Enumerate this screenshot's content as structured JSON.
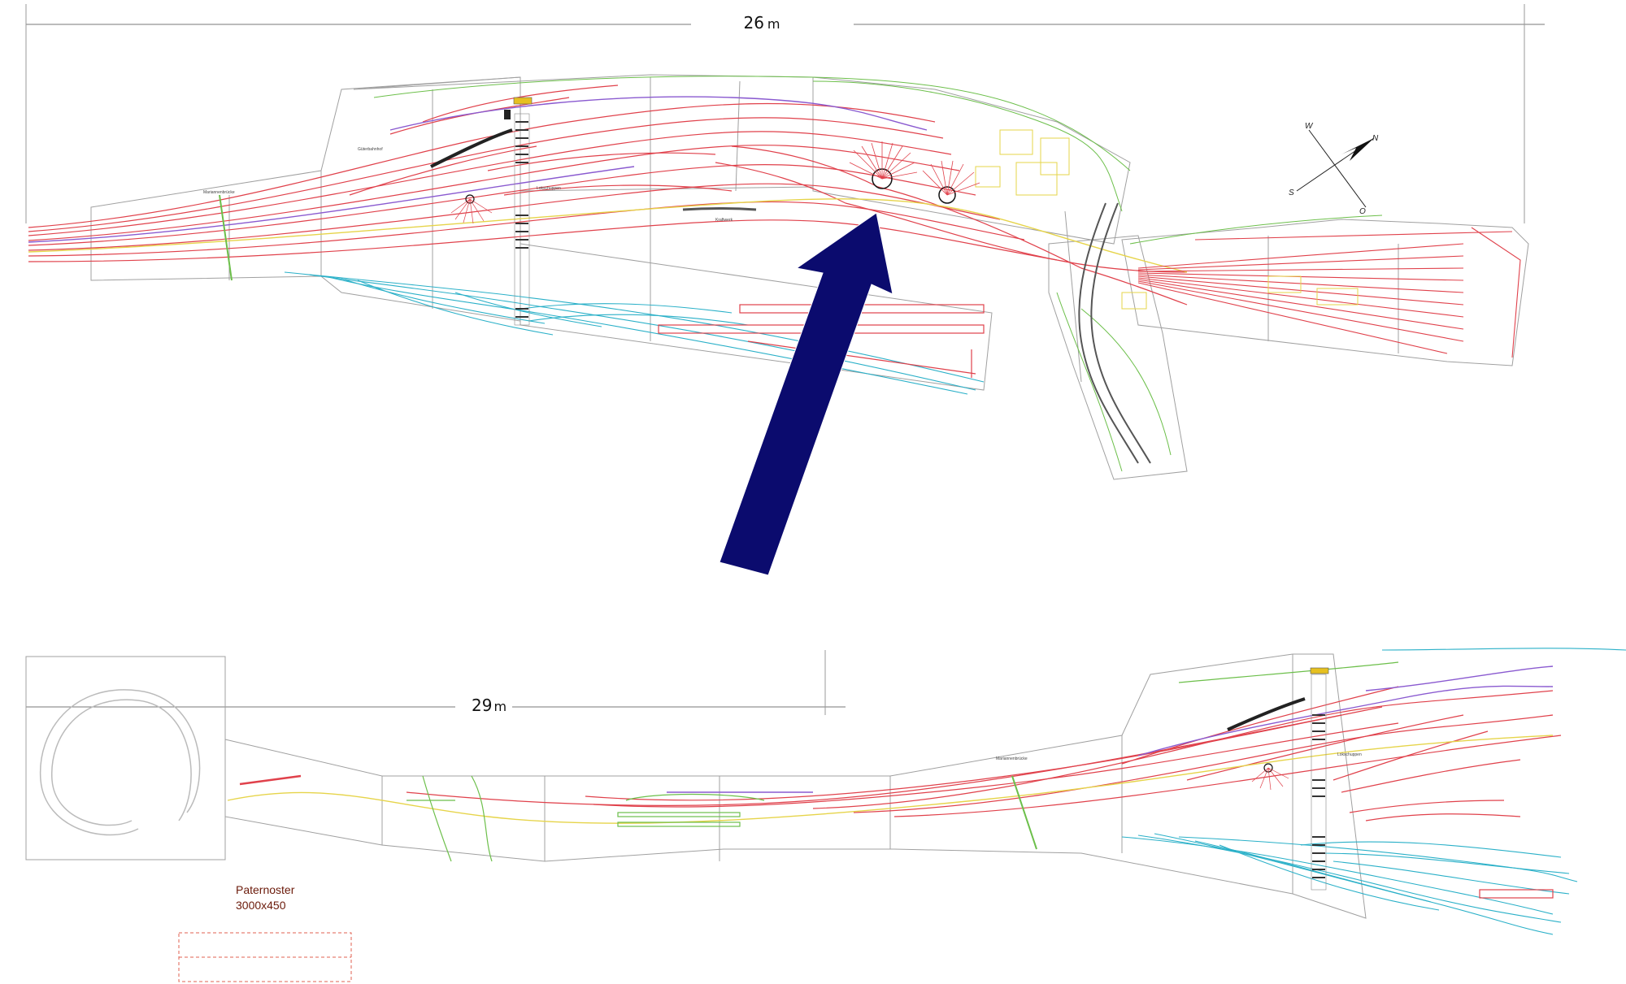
{
  "top_plan": {
    "dimension_value": "26",
    "dimension_unit": "m"
  },
  "bottom_plan": {
    "dimension_value": "29",
    "dimension_unit": "m"
  },
  "compass": {
    "north": "N",
    "south": "S",
    "west": "W",
    "east": "O"
  },
  "labels": {
    "bridge_top": "Mariannenbrücke",
    "bridge_bottom": "Mariannenbrücke",
    "freight_top": "Güterbahnhof",
    "depot": "Lokschuppen",
    "loco_shed": "Lokschuppen",
    "industry": "Kraftwerk"
  },
  "paternoster": {
    "title": "Paternoster",
    "size": "3000x450"
  },
  "arrow": {
    "color": "#0b0b6e",
    "direction": "points-to-turntable"
  },
  "colors": {
    "main_track": "#e0414b",
    "yard_track": "#2ab0c8",
    "scenery": "#6cbf4a",
    "buildings": "#e6d44a",
    "purple_line": "#8a5ad0",
    "outline": "#9a9a9a"
  }
}
